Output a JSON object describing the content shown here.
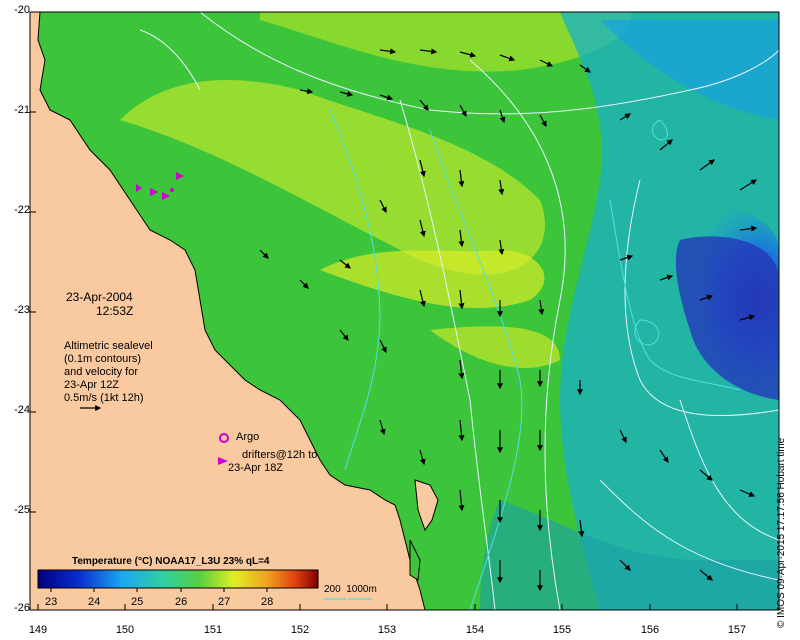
{
  "map": {
    "axes": {
      "lat_ticks": [
        "-20",
        "-21",
        "-22",
        "-23",
        "-24",
        "-25",
        "-26"
      ],
      "lon_ticks": [
        "149",
        "150",
        "151",
        "152",
        "153",
        "154",
        "155",
        "156",
        "157"
      ],
      "lat_range": [
        -26,
        -20
      ],
      "lon_range": [
        149,
        157
      ]
    },
    "date": "23-Apr-2004",
    "time": "12:53Z",
    "legend_text": [
      "Altimetric sealevel",
      "(0.1m contours)",
      "and velocity for",
      "23-Apr 12Z",
      "0.5m/s (1kt 12h)"
    ],
    "argo_label": "Argo",
    "drifters_label": [
      "drifters@12h to",
      "23-Apr 18Z"
    ],
    "colorbar": {
      "title": "Temperature (°C) NOAA17_L3U 23% qL=4",
      "ticks": [
        "23",
        "24",
        "25",
        "26",
        "27",
        "28"
      ],
      "range": [
        22.5,
        29
      ]
    },
    "contour_legend": "200  1000m",
    "credit": "© IMOS 09-Apr-2015 17:17:56 Hobart time",
    "colors": {
      "land": "#f9c9a0",
      "sea_warm": "#33c83a",
      "sea_cool": "#1aa0d8",
      "sea_cold": "#2438b8",
      "contour": "#e8f4ff",
      "bathy": "#4fe0e0",
      "argo": "#cc00cc"
    }
  }
}
